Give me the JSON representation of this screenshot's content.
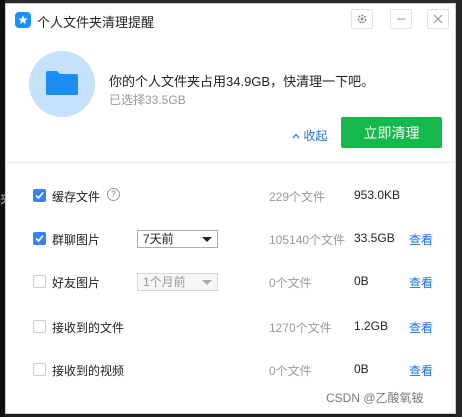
{
  "window": {
    "title": "个人文件夹清理提醒"
  },
  "background_fragment": "夹",
  "header": {
    "message": "你的个人文件夹占用34.9GB，快清理一下吧。",
    "selected": "已选择33.5GB",
    "collapse_label": "收起",
    "clean_button": "立即清理"
  },
  "items": [
    {
      "label": "缓存文件",
      "checked": true,
      "has_help": true,
      "count": "229个文件",
      "size": "953.0KB"
    },
    {
      "label": "群聊图片",
      "checked": true,
      "dropdown": "7天前",
      "count": "105140个文件",
      "size": "33.5GB",
      "action": "查看"
    },
    {
      "label": "好友图片",
      "checked": false,
      "dropdown": "1个月前",
      "dropdown_disabled": true,
      "count": "0个文件",
      "size": "0B",
      "action": "查看"
    },
    {
      "label": "接收到的文件",
      "checked": false,
      "count": "1270个文件",
      "size": "1.2GB",
      "action": "查看"
    },
    {
      "label": "接收到的视频",
      "checked": false,
      "count": "0个文件",
      "size": "0B",
      "action": "查看"
    }
  ],
  "watermark": "CSDN @乙酸氧铍",
  "colors": {
    "accent": "#15b84a",
    "link": "#1a73e8",
    "checkbox": "#3d7ff5",
    "folder": "#1890ff"
  }
}
